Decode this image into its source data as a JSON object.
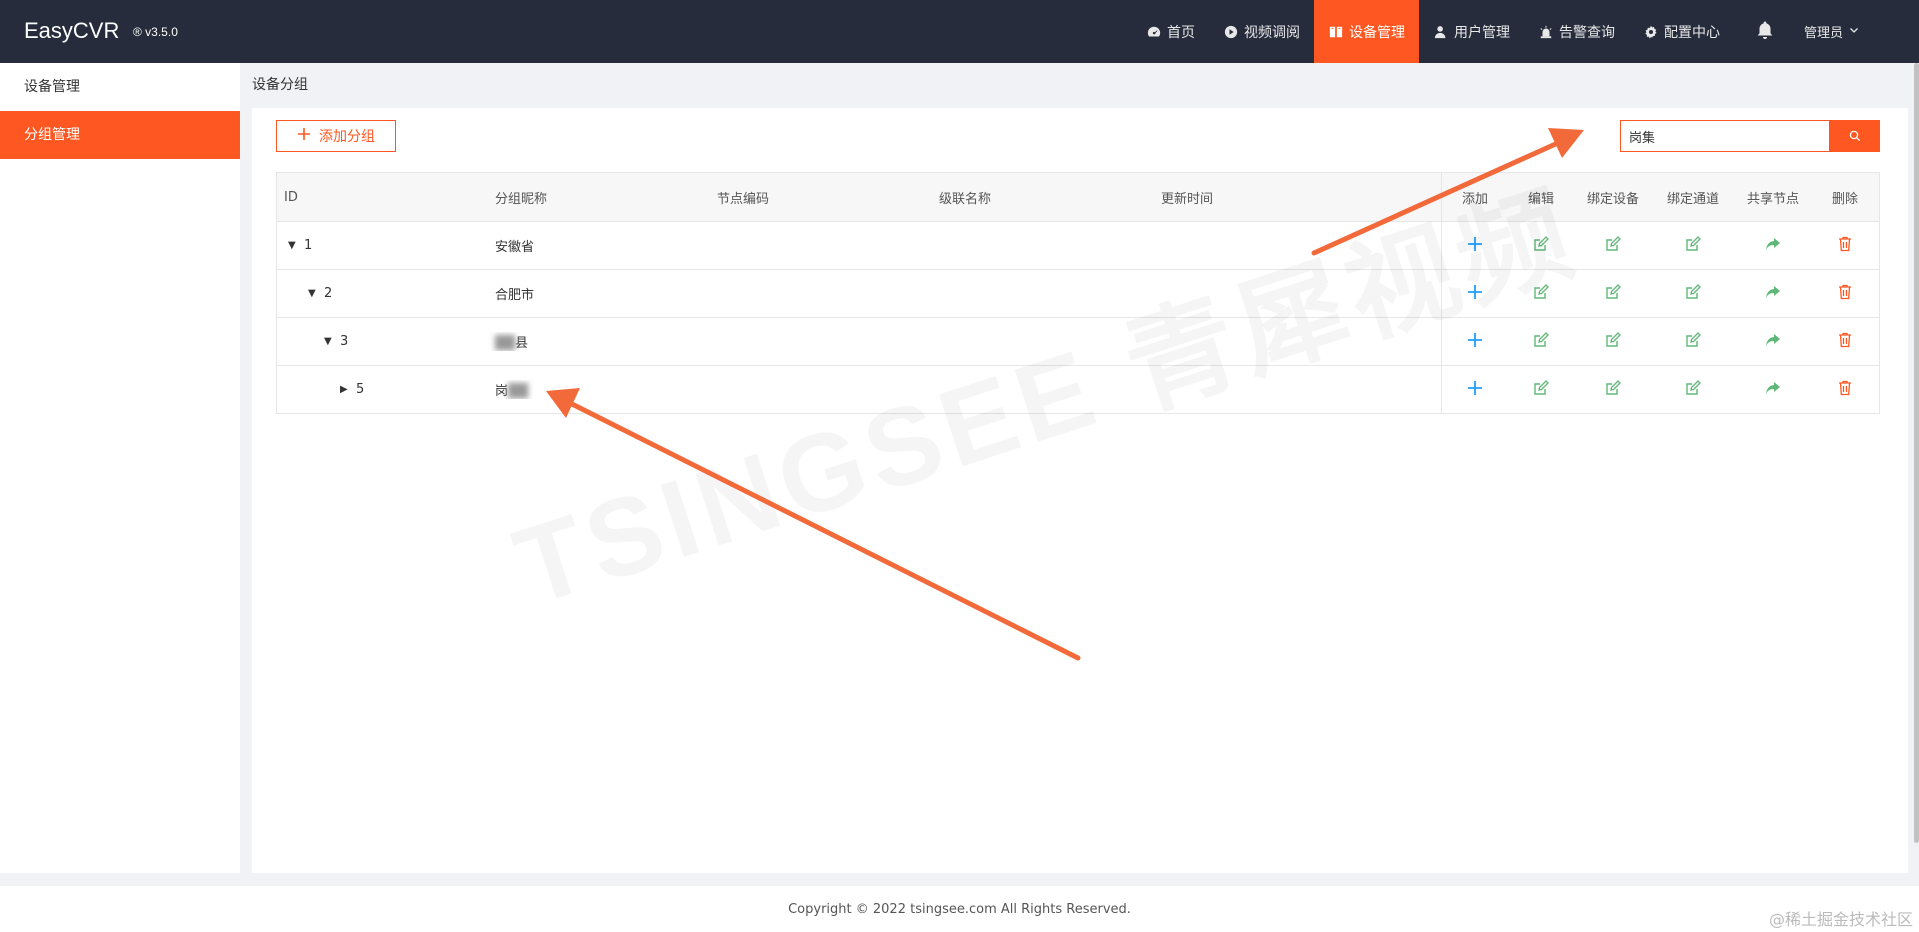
{
  "app": {
    "name": "EasyCVR",
    "version": "® v3.5.0"
  },
  "nav": {
    "items": [
      {
        "label": "首页",
        "icon": "dashboard-icon"
      },
      {
        "label": "视频调阅",
        "icon": "play-icon"
      },
      {
        "label": "设备管理",
        "icon": "book-icon",
        "active": true
      },
      {
        "label": "用户管理",
        "icon": "user-icon"
      },
      {
        "label": "告警查询",
        "icon": "alarm-icon"
      },
      {
        "label": "配置中心",
        "icon": "gear-icon"
      }
    ],
    "user": "管理员"
  },
  "sidebar": {
    "items": [
      {
        "label": "设备管理"
      },
      {
        "label": "分组管理",
        "active": true
      }
    ]
  },
  "main": {
    "title": "设备分组",
    "add_button": "添加分组",
    "search": {
      "value": "岗集",
      "placeholder": ""
    }
  },
  "table": {
    "headers": {
      "id": "ID",
      "name": "分组昵称",
      "code": "节点编码",
      "cascade": "级联名称",
      "time": "更新时间",
      "add": "添加",
      "edit": "编辑",
      "bind_device": "绑定设备",
      "bind_channel": "绑定通道",
      "share": "共享节点",
      "delete": "删除"
    },
    "rows": [
      {
        "id": "1",
        "name": "安徽省",
        "expanded": true
      },
      {
        "id": "2",
        "name": "合肥市",
        "expanded": true
      },
      {
        "id": "3",
        "name": "县",
        "expanded": true
      },
      {
        "id": "5",
        "name": "岗",
        "expanded": false
      }
    ]
  },
  "footer": {
    "copyright": "Copyright © 2022 tsingsee.com All Rights Reserved."
  },
  "watermark": {
    "text": "TSINGSEE 青犀视频",
    "corner": "@稀土掘金技术社区"
  },
  "colors": {
    "accent": "#ff5722",
    "topbar": "#262c3b",
    "add_icon": "#1e9fff",
    "edit_icon": "#5fb878",
    "delete_icon": "#ff5722"
  }
}
